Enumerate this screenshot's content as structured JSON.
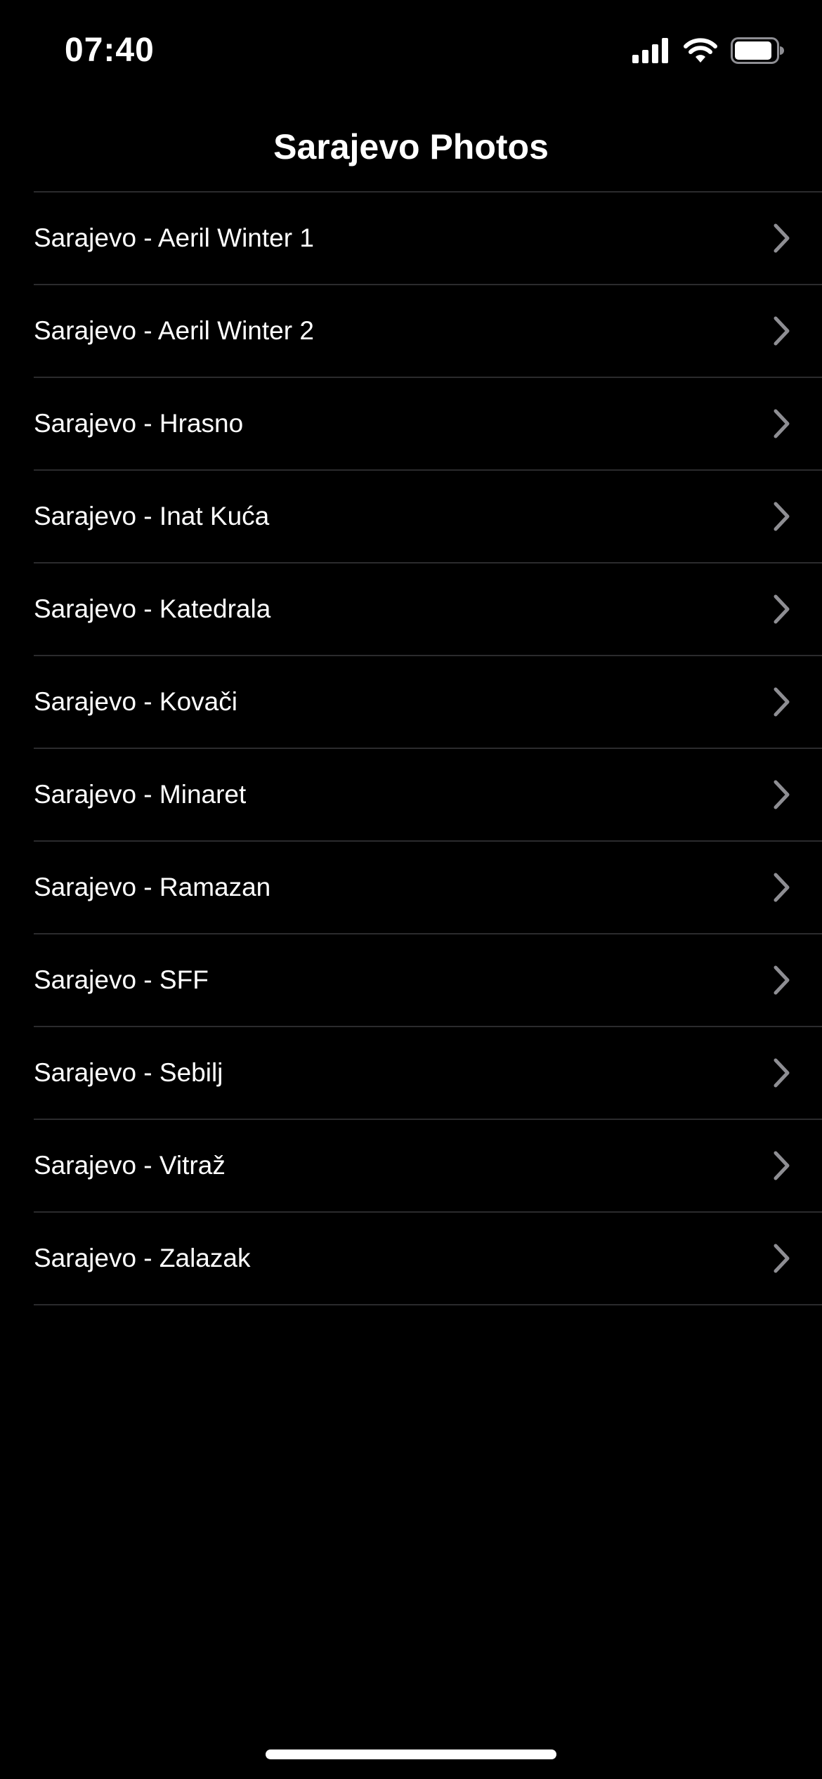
{
  "status_bar": {
    "time": "07:40"
  },
  "nav": {
    "title": "Sarajevo Photos"
  },
  "list": {
    "items": [
      {
        "label": "Sarajevo - Aeril Winter 1"
      },
      {
        "label": "Sarajevo - Aeril Winter 2"
      },
      {
        "label": "Sarajevo - Hrasno"
      },
      {
        "label": "Sarajevo - Inat Kuća"
      },
      {
        "label": "Sarajevo - Katedrala"
      },
      {
        "label": "Sarajevo - Kovači"
      },
      {
        "label": "Sarajevo - Minaret"
      },
      {
        "label": "Sarajevo - Ramazan"
      },
      {
        "label": "Sarajevo - SFF"
      },
      {
        "label": "Sarajevo - Sebilj"
      },
      {
        "label": "Sarajevo - Vitraž"
      },
      {
        "label": "Sarajevo - Zalazak"
      }
    ]
  },
  "icons": {
    "row_accessory": "chevron-right-icon",
    "signal": "cellular-signal-icon",
    "wifi": "wifi-icon",
    "battery": "battery-icon"
  },
  "colors": {
    "background": "#000000",
    "text": "#ffffff",
    "separator": "#2b2b2d",
    "chevron": "#8e8e93"
  }
}
